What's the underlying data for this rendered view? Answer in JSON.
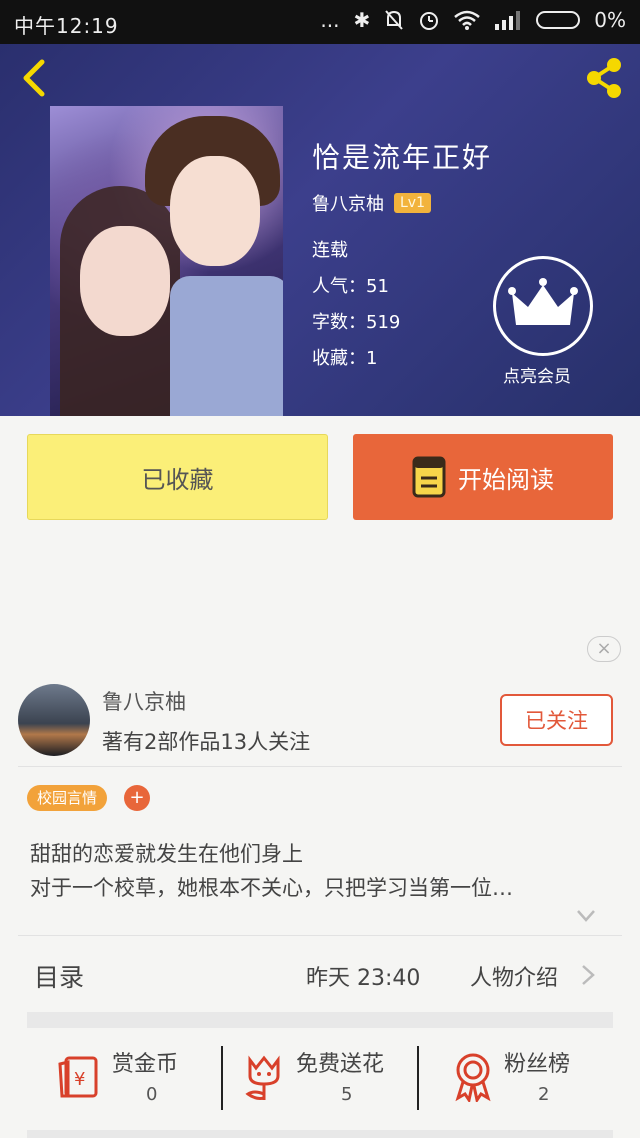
{
  "status_bar": {
    "time": "中午12:19",
    "dots": "...",
    "bluetooth_symbol": "✱",
    "battery_text": "0%"
  },
  "header": {
    "back_icon": "chevron-left-icon",
    "share_icon": "share-icon",
    "accent_color": "#f5d800"
  },
  "book": {
    "title": "恰是流年正好",
    "author": "鲁八京柚",
    "level": "Lv1",
    "status": "连载",
    "popularity": "人气：51",
    "word_count": "字数：519",
    "favorites": "收藏：1",
    "vip_label": "点亮会员"
  },
  "actions": {
    "favorited_label": "已收藏",
    "read_label": "开始阅读",
    "favorited_color": "#fbef78",
    "read_color": "#e8663a"
  },
  "close_symbol": "×",
  "author_card": {
    "name": "鲁八京柚",
    "stats": "著有2部作品13人关注",
    "follow_label": "已关注"
  },
  "tags": {
    "items": [
      "校园言情"
    ],
    "add_label": "+"
  },
  "description": {
    "line1": "甜甜的恋爱就发生在他们身上",
    "line2": "对于一个校草，她根本不关心，只把学习当第一位…"
  },
  "toc": {
    "label": "目录",
    "updated": "昨天 23:40",
    "characters_label": "人物介绍"
  },
  "stats": [
    {
      "label": "赏金币",
      "value": "0",
      "icon": "red-envelope-icon"
    },
    {
      "label": "免费送花",
      "value": "5",
      "icon": "flower-icon"
    },
    {
      "label": "粉丝榜",
      "value": "2",
      "icon": "medal-icon"
    }
  ]
}
